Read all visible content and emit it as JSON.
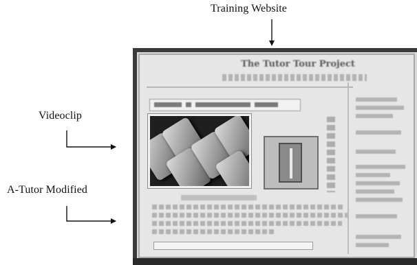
{
  "annotations": {
    "training_website": "Training Website",
    "videoclip": "Videoclip",
    "atutor_modified": "A-Tutor Modified"
  },
  "screen": {
    "site_title": "The Tutor Tour Project"
  },
  "colors": {
    "text": "#111111",
    "arrow": "#111111",
    "screen_bg": "#e6e6e6",
    "bezel": "#3a3a3a"
  }
}
